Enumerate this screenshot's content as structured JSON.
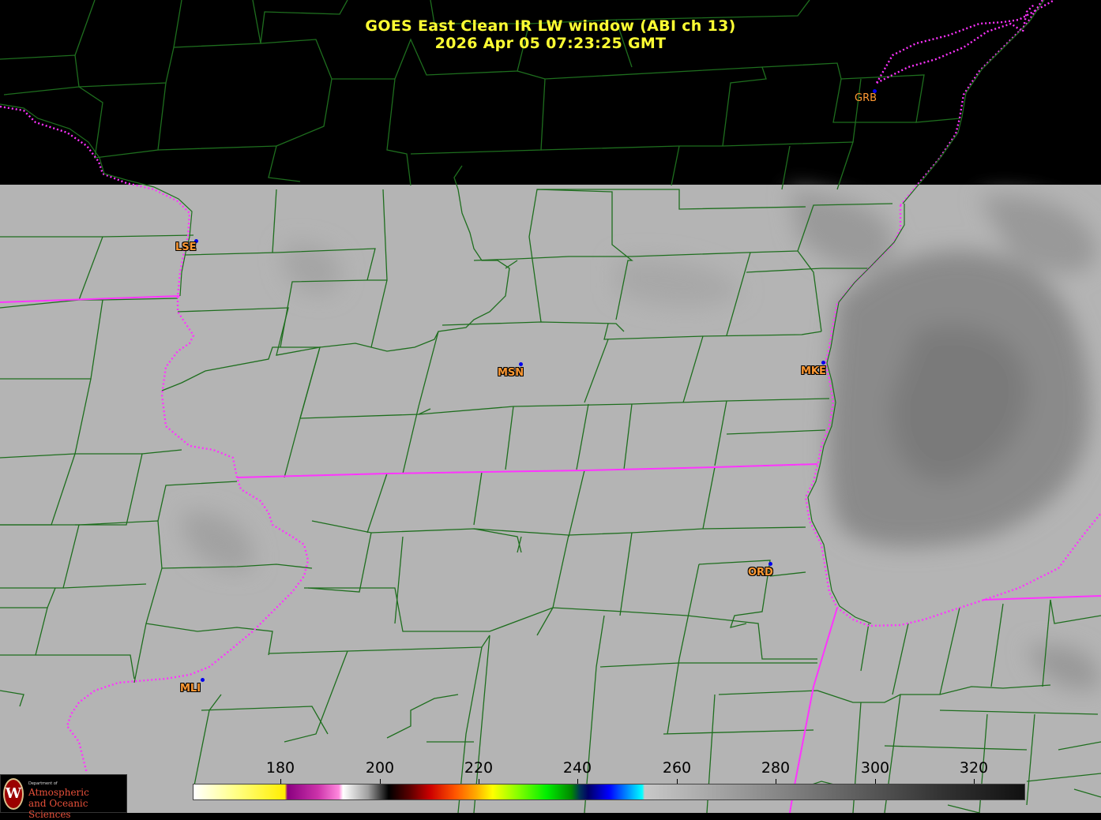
{
  "title": {
    "line1": "GOES East Clean IR LW window (ABI ch 13)",
    "line2": "2026 Apr 05  07:23:25 GMT"
  },
  "stations": {
    "grb": "GRB",
    "lse": "LSE",
    "msn": "MSN",
    "mke": "MKE",
    "ord": "ORD",
    "mli": "MLI"
  },
  "colorbar": {
    "ticks": [
      "180",
      "200",
      "220",
      "240",
      "260",
      "280",
      "300",
      "320"
    ]
  },
  "logo": {
    "dept": "Department of",
    "line1": "Atmospheric",
    "line2": "and Oceanic Sciences",
    "shield_letter": "W"
  },
  "colors": {
    "title": "#ffff33",
    "county_lines": "#1e6e1e",
    "state_lines": "#ff33ff",
    "station_labels": "#ff9933",
    "station_dots": "#0000ee"
  }
}
